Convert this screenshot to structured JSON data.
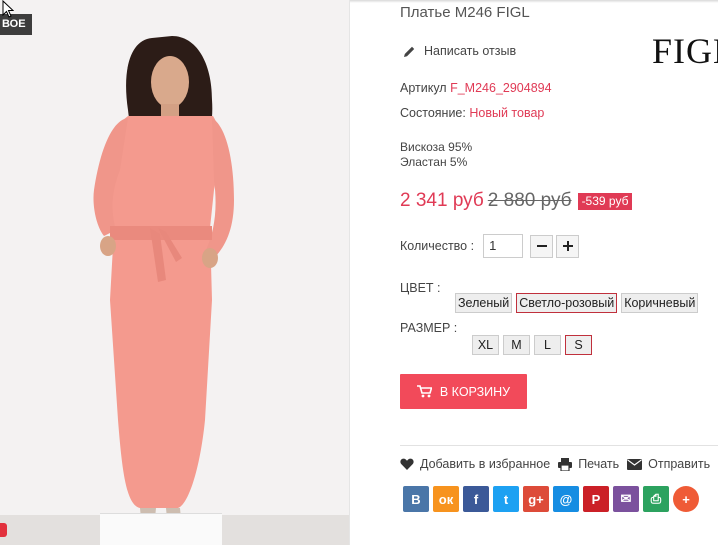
{
  "badge": {
    "label": "ВОЕ"
  },
  "product": {
    "title": "Платье M246 FIGL",
    "brand": "FIGL",
    "review_link": "Написать отзыв",
    "sku_label": "Артикул",
    "sku_value": "F_M246_2904894",
    "condition_label": "Состояние:",
    "condition_value": "Новый товар",
    "composition": [
      "Вискоза 95%",
      "Эластан 5%"
    ]
  },
  "price": {
    "current": "2 341 руб",
    "old": "2 880 руб",
    "discount": "-539 руб"
  },
  "quantity": {
    "label": "Количество :",
    "value": "1",
    "minus": "−",
    "plus": "+"
  },
  "color": {
    "label": "ЦВЕТ :",
    "options": [
      "Зеленый",
      "Светло-розовый",
      "Коричневый"
    ],
    "selected": "Светло-розовый"
  },
  "size": {
    "label": "РАЗМЕР :",
    "options": [
      "XL",
      "M",
      "L",
      "S"
    ],
    "selected": "S"
  },
  "cart": {
    "label": "В КОРЗИНУ"
  },
  "actions": {
    "favorite": "Добавить в избранное",
    "print": "Печать",
    "send": "Отправить"
  },
  "social": [
    {
      "icon": "vk-icon",
      "glyph": "В",
      "color": "#4a76a8"
    },
    {
      "icon": "odnoklassniki-icon",
      "glyph": "ок",
      "color": "#f7931e"
    },
    {
      "icon": "facebook-icon",
      "glyph": "f",
      "color": "#3b5998"
    },
    {
      "icon": "twitter-icon",
      "glyph": "t",
      "color": "#1da1f2"
    },
    {
      "icon": "google-plus-icon",
      "glyph": "g+",
      "color": "#dd4b39"
    },
    {
      "icon": "mail-ru-icon",
      "glyph": "@",
      "color": "#168de2"
    },
    {
      "icon": "pinterest-icon",
      "glyph": "P",
      "color": "#cb2027"
    },
    {
      "icon": "email-icon",
      "glyph": "✉",
      "color": "#7b519d"
    },
    {
      "icon": "print-share-icon",
      "glyph": "⎙",
      "color": "#2ca25f"
    },
    {
      "icon": "more-share-icon",
      "glyph": "+",
      "color": "#ef5b36"
    }
  ],
  "colors": {
    "accent": "#e03a55",
    "cart_button": "#f24a5a",
    "selected_border": "#c0303c"
  }
}
